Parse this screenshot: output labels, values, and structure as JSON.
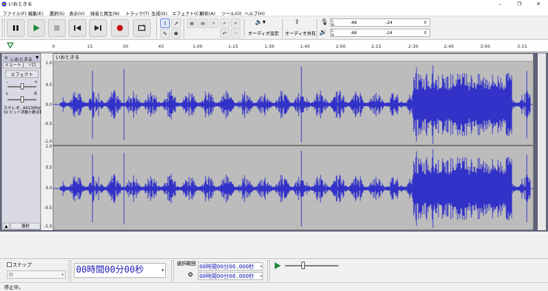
{
  "window": {
    "title": "いおときる",
    "buttons": [
      "–",
      "❐",
      "✕"
    ]
  },
  "menu": [
    "ファイル(F)",
    "編集(E)",
    "選択(S)",
    "表示(V)",
    "録音と再生(N)",
    "トラック(T)",
    "生成(G)",
    "エフェクト(C)",
    "解析(A)",
    "ツール(O)",
    "ヘルプ(H)"
  ],
  "toolbar": {
    "audio_setup_label": "オーディオ設定",
    "audio_share_label": "オーディオ共有",
    "meter_ticks": [
      "-48",
      "-24",
      "0"
    ],
    "meter_channels": [
      "L",
      "R"
    ]
  },
  "ruler": {
    "ticks": [
      "0",
      "15",
      "30",
      "45",
      "1:00",
      "1:15",
      "1:30",
      "1:45",
      "2:00",
      "2:15",
      "2:30",
      "2:45",
      "3:00",
      "3:15"
    ]
  },
  "track": {
    "name": "いおときる",
    "close_glyph": "✕",
    "menu_glyph": "▼",
    "mute_label": "ミュート",
    "solo_label": "ソロ",
    "effects_label": "エフェクト",
    "gain_minus": "–",
    "gain_plus": "+",
    "pan_left": "L",
    "pan_right": "R",
    "info_line1": "ステレオ, 44100Hz",
    "info_line2": "32 ビット浮動小数点数",
    "select_label": "選択",
    "collapse_glyph": "▲",
    "clip_name": "いおときる",
    "y_ticks": [
      "1.0",
      "0.5",
      "0.0",
      "-0.5",
      "-1.0"
    ]
  },
  "bottom": {
    "snap_label": "スナップ",
    "snap_unit": "秒",
    "time_display": "00時間00分00秒",
    "selection_label": "選択範囲",
    "selection_start": "00時間00分00.000秒",
    "selection_end": "00時間00分00.000秒"
  },
  "status": {
    "text": "停止中。"
  },
  "colors": {
    "waveform": "#3232c8",
    "track_bg": "#bcbcbc",
    "workspace_bg": "#5e6378",
    "record": "#c81414"
  }
}
